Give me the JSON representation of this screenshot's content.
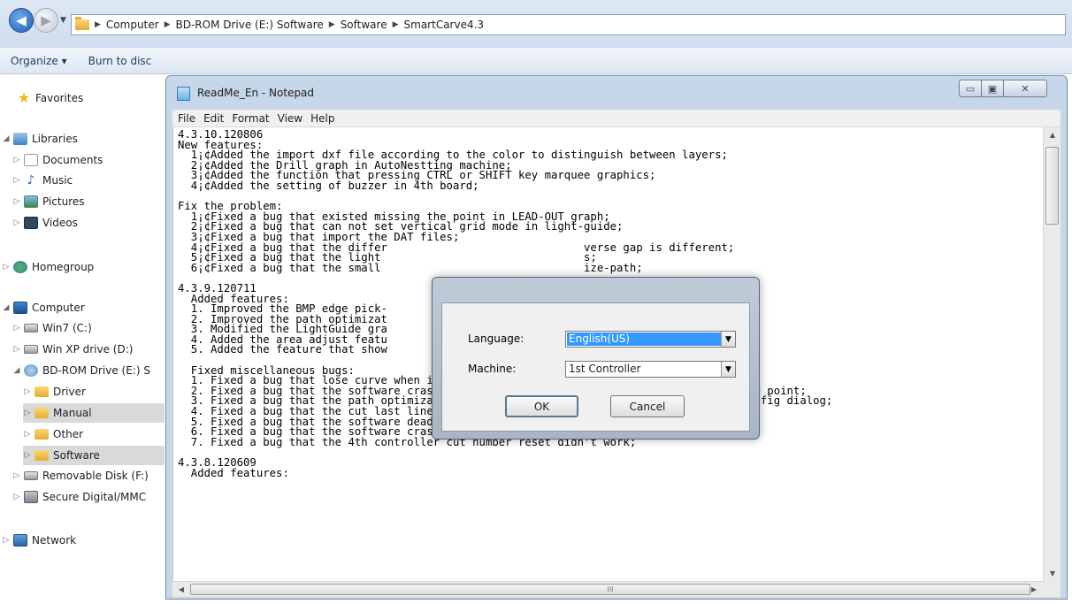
{
  "explorer": {
    "breadcrumb": [
      "Computer",
      "BD-ROM Drive (E:) Software",
      "Software",
      "SmartCarve4.3"
    ],
    "toolbar": {
      "organize": "Organize ▾",
      "burn": "Burn to disc"
    },
    "nav": [
      {
        "label": "Favorites",
        "icon": "star-icon"
      },
      {
        "label": "Libraries",
        "icon": "libraries-icon"
      },
      {
        "label": "Documents",
        "icon": "documents-icon"
      },
      {
        "label": "Music",
        "icon": "music-icon"
      },
      {
        "label": "Pictures",
        "icon": "pictures-icon"
      },
      {
        "label": "Videos",
        "icon": "videos-icon"
      },
      {
        "label": "Homegroup",
        "icon": "homegroup-icon"
      },
      {
        "label": "Computer",
        "icon": "computer-icon"
      },
      {
        "label": "Win7 (C:)",
        "icon": "drive-icon"
      },
      {
        "label": "Win XP drive (D:)",
        "icon": "drive-icon"
      },
      {
        "label": "BD-ROM Drive (E:) S",
        "icon": "bd-rom-icon"
      },
      {
        "label": "Driver",
        "icon": "folder-icon"
      },
      {
        "label": "Manual",
        "icon": "folder-icon"
      },
      {
        "label": "Other",
        "icon": "folder-icon"
      },
      {
        "label": "Software",
        "icon": "folder-icon"
      },
      {
        "label": "Removable Disk (F:)",
        "icon": "removable-disk-icon"
      },
      {
        "label": "Secure Digital/MMC",
        "icon": "sd-card-icon"
      },
      {
        "label": "Network",
        "icon": "network-icon"
      }
    ]
  },
  "notepad": {
    "title": "ReadMe_En - Notepad",
    "menu": [
      "File",
      "Edit",
      "Format",
      "View",
      "Help"
    ],
    "caption_buttons": {
      "minimize": "▭",
      "maximize": "▣",
      "close": "✕"
    },
    "lines": [
      "4.3.10.120806",
      "New features:",
      "  1¡¢Added the import dxf file according to the color to distinguish between layers;",
      "  2¡¢Added the Drill graph in AutoNestting machine;",
      "  3¡¢Added the function that pressing CTRL or SHIFT key marquee graphics;",
      "  4¡¢Added the setting of buzzer in 4th board;",
      "",
      "Fix the problem:",
      "  1¡¢Fixed a bug that existed missing the point in LEAD-OUT graph;",
      "  2¡¢Fixed a bug that can not set vertical grid mode in light-guide;",
      "  3¡¢Fixed a bug that import the DAT files;",
      "  4¡¢Fixed a bug that the differ                              verse gap is different;",
      "  5¡¢Fixed a bug that the light                               s;",
      "  6¡¢Fixed a bug that the small                               ize-path;",
      "",
      "4.3.9.120711",
      "  Added features:",
      "  1. Improved the BMP edge pick-",
      "  2. Improved the path optimizat                              more celerity;",
      "  3. Modified the LightGuide gra                              oller(V3.0.03);",
      "  4. Added the area adjust featu",
      "  5. Added the feature that show                              ind the overlap curve;",
      "",
      "  Fixed miscellaneous bugs:",
      "  1. Fixed a bug that lose curve when importing some *.dat file;",
      "  2. Fixed a bug that the software crash when shrink or expand the curve including 2 same point;",
      "  3. Fixed a bug that the path optimization parameters changed when open the software config dialog;",
      "  4. Fixed a bug that the cut last line no laser in CMA1625F machine;",
      "  5. Fixed a bug that the software dead cycle sometime when find the overlap curve;",
      "  6. Fixed a bug that the software crash when importing some *.dxf file;",
      "  7. Fixed a bug that the 4th controller cut number reset didn't work;",
      "",
      "4.3.8.120609",
      "  Added features:"
    ]
  },
  "dialog": {
    "language_label": "Language:",
    "language_value": "English(US)",
    "machine_label": "Machine:",
    "machine_value": "1st Controller",
    "ok": "OK",
    "cancel": "Cancel"
  }
}
